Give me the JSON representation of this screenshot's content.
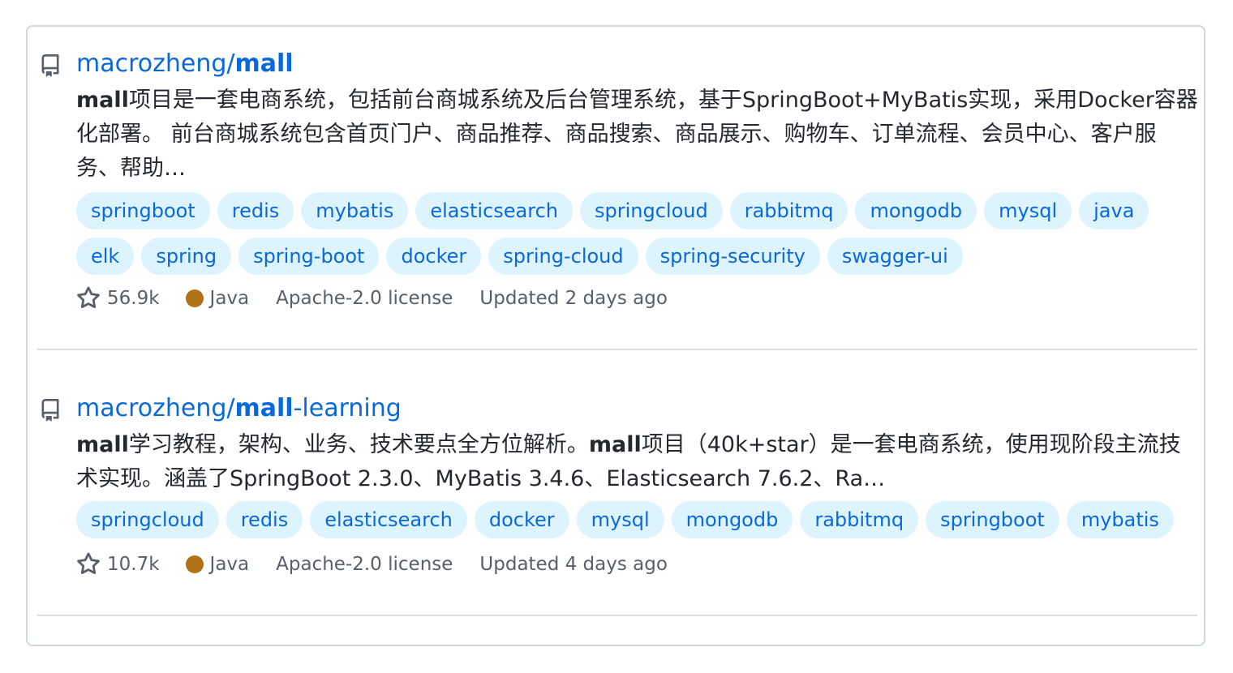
{
  "results": [
    {
      "owner": "macrozheng/",
      "repo_bold": "mall",
      "repo_rest": "",
      "desc_bold": "mall",
      "desc_text": "项目是一套电商系统，包括前台商城系统及后台管理系统，基于SpringBoot+MyBatis实现，采用Docker容器化部署。 前台商城系统包含首页门户、商品推荐、商品搜索、商品展示、购物车、订单流程、会员中心、客户服务、帮助…",
      "topics": [
        "springboot",
        "redis",
        "mybatis",
        "elasticsearch",
        "springcloud",
        "rabbitmq",
        "mongodb",
        "mysql",
        "java",
        "elk",
        "spring",
        "spring-boot",
        "docker",
        "spring-cloud",
        "spring-security",
        "swagger-ui"
      ],
      "stars": "56.9k",
      "language": "Java",
      "language_color": "#b07219",
      "license": "Apache-2.0 license",
      "updated": "Updated 2 days ago"
    },
    {
      "owner": "macrozheng/",
      "repo_bold": "mall",
      "repo_rest": "-learning",
      "desc_bold": "mall",
      "desc_text": "学习教程，架构、业务、技术要点全方位解析。",
      "desc_bold2": "mall",
      "desc_text2": "项目（40k+star）是一套电商系统，使用现阶段主流技术实现。涵盖了SpringBoot 2.3.0、MyBatis 3.4.6、Elasticsearch 7.6.2、Ra…",
      "topics": [
        "springcloud",
        "redis",
        "elasticsearch",
        "docker",
        "mysql",
        "mongodb",
        "rabbitmq",
        "springboot",
        "mybatis"
      ],
      "stars": "10.7k",
      "language": "Java",
      "language_color": "#b07219",
      "license": "Apache-2.0 license",
      "updated": "Updated 4 days ago"
    }
  ],
  "icons": {
    "repo": "repo-icon",
    "star": "star-icon"
  },
  "colors": {
    "link": "#0969da",
    "topic_bg": "#ddf4ff",
    "muted": "#57606a"
  }
}
